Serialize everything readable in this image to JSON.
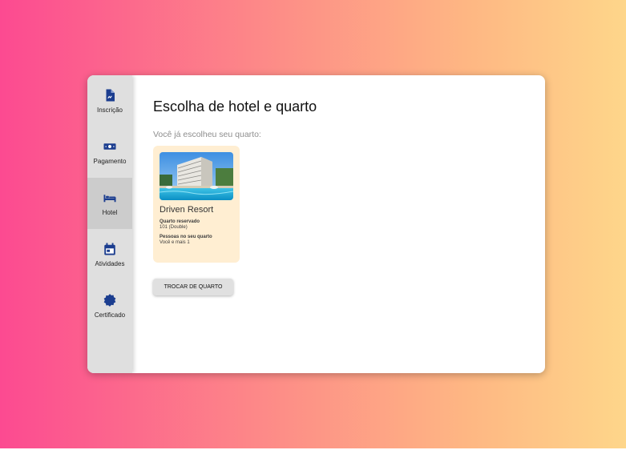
{
  "sidebar": {
    "items": [
      {
        "label": "Inscrição",
        "icon": "document-icon"
      },
      {
        "label": "Pagamento",
        "icon": "money-icon"
      },
      {
        "label": "Hotel",
        "icon": "bed-icon",
        "active": true
      },
      {
        "label": "Atividades",
        "icon": "calendar-icon"
      },
      {
        "label": "Certificado",
        "icon": "certificate-icon"
      }
    ]
  },
  "main": {
    "title": "Escolha de hotel e quarto",
    "subtitle": "Você já escolheu seu quarto:",
    "hotel": {
      "name": "Driven Resort",
      "room_label": "Quarto reservado",
      "room_value": "101 (Double)",
      "people_label": "Pessoas no seu quarto",
      "people_value": "Você e mais 1"
    },
    "swap_button_label": "TROCAR DE QUARTO"
  },
  "colors": {
    "accent": "#1b3d8f",
    "card_background": "#ffeed2",
    "sidebar_background": "#dfdfdf",
    "sidebar_active": "#cccccc"
  }
}
